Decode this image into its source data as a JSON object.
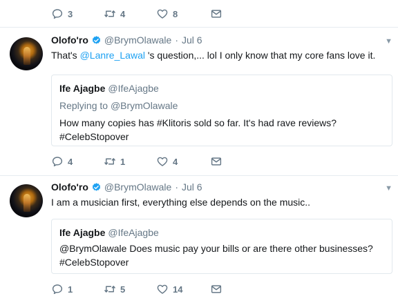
{
  "top_actions": {
    "reply_count": "3",
    "retweet_count": "4",
    "like_count": "8"
  },
  "tweets": [
    {
      "author_name": "Olofo'ro",
      "author_handle": "@BrymOlawale",
      "separator": "·",
      "timestamp": "Jul 6",
      "text_mention": "@Lanre_Lawal",
      "text_prefix": "That's ",
      "text_suffix": " 's question,... lol I only know that my core fans love it.",
      "quote": {
        "name": "Ife Ajagbe",
        "handle": "@IfeAjagbe",
        "replying_prefix": "Replying to ",
        "replying_handle": "@BrymOlawale",
        "text_line1": "How many copies has #Klitoris sold so far. It's had rave reviews?",
        "text_line2": "#CelebStopover"
      },
      "actions": {
        "reply_count": "4",
        "retweet_count": "1",
        "like_count": "4"
      }
    },
    {
      "author_name": "Olofo'ro",
      "author_handle": "@BrymOlawale",
      "separator": "·",
      "timestamp": "Jul 6",
      "text": "I am a musician first, everything else depends on the music..",
      "quote": {
        "name": "Ife Ajagbe",
        "handle": "@IfeAjagbe",
        "text_line1": "@BrymOlawale Does music pay your bills or are there other businesses?",
        "text_line2": "#CelebStopover"
      },
      "actions": {
        "reply_count": "1",
        "retweet_count": "5",
        "like_count": "14"
      }
    }
  ],
  "icons": {
    "reply": "reply-icon",
    "retweet": "retweet-icon",
    "like": "heart-icon",
    "dm": "envelope-icon",
    "verified": "verified-badge-icon",
    "caret": "chevron-down-icon"
  },
  "colors": {
    "link": "#1da1f2",
    "muted": "#657786",
    "border": "#e6ecf0",
    "verified": "#1da1f2"
  }
}
